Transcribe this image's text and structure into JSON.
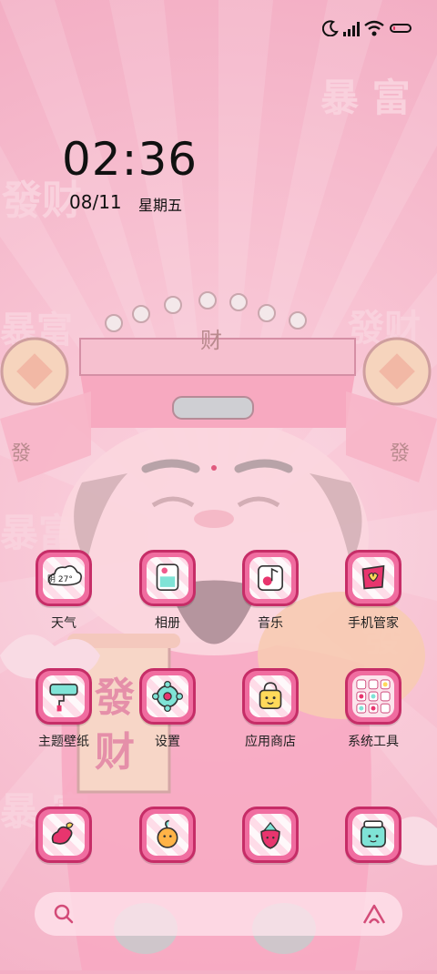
{
  "status_bar": {
    "icons": [
      "moon-icon",
      "signal-icon",
      "wifi-icon",
      "battery-icon"
    ],
    "battery_level": 0.15,
    "battery_color": "#e32c5a"
  },
  "clock": {
    "time": "02:36",
    "date": "08/11",
    "weekday": "星期五"
  },
  "wallpaper": {
    "watermarks": [
      "暴 富",
      "發财",
      "暴富",
      "發财",
      "暴富",
      "發财",
      "暴 富"
    ],
    "coin_chars": [
      "财",
      "發",
      "發"
    ],
    "scroll_chars": [
      "發",
      "财"
    ]
  },
  "apps": [
    {
      "label": "天气",
      "icon": "weather-icon",
      "badge": "阴 27°"
    },
    {
      "label": "相册",
      "icon": "gallery-icon"
    },
    {
      "label": "音乐",
      "icon": "music-icon"
    },
    {
      "label": "手机管家",
      "icon": "security-icon"
    },
    {
      "label": "主题壁纸",
      "icon": "theme-icon"
    },
    {
      "label": "设置",
      "icon": "settings-icon"
    },
    {
      "label": "应用商店",
      "icon": "app-store-icon"
    },
    {
      "label": "系统工具",
      "icon": "tools-folder-icon"
    },
    {
      "label": "",
      "icon": "sticker-icon"
    },
    {
      "label": "",
      "icon": "orange-icon"
    },
    {
      "label": "",
      "icon": "strawberry-icon"
    },
    {
      "label": "",
      "icon": "jar-icon"
    }
  ],
  "colors": {
    "icon_frame": "#c62d67",
    "icon_fill": "#f06da0",
    "background": "#f7bfd0"
  }
}
